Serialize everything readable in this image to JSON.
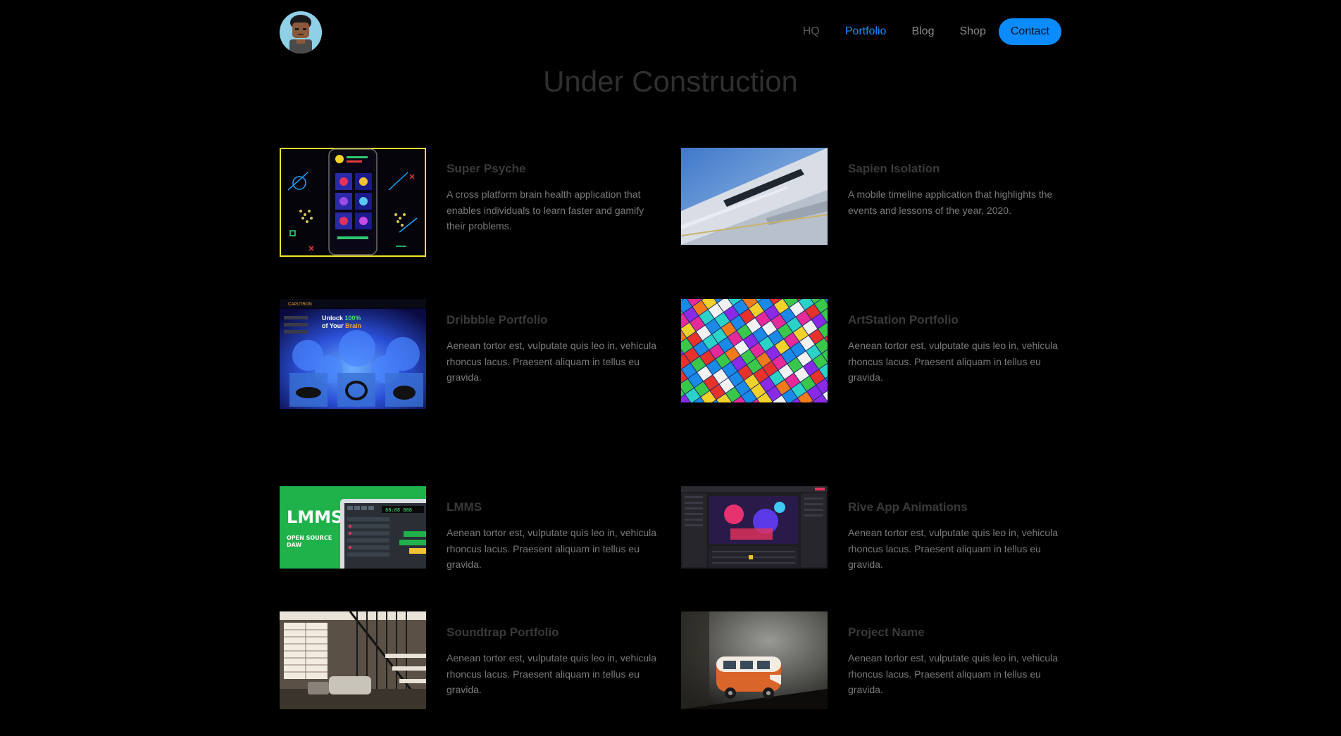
{
  "nav": {
    "items": [
      {
        "label": "HQ"
      },
      {
        "label": "Portfolio"
      },
      {
        "label": "Blog"
      },
      {
        "label": "Shop"
      },
      {
        "label": "Contact"
      }
    ],
    "active_color": "#1a8cff",
    "contact_bg": "#0a8bff"
  },
  "page": {
    "title": "Under Construction"
  },
  "projects": [
    {
      "title": "Super Psyche",
      "description": "A cross platform brain health application that enables individuals to learn faster and gamify their problems.",
      "thumb_text": ""
    },
    {
      "title": "Sapien Isolation",
      "description": "A mobile timeline application that highlights the events and lessons of the year, 2020."
    },
    {
      "title": "Dribbble Portfolio",
      "description": "Aenean tortor est, vulputate quis leo in, vehicula rhoncus lacus. Praesent aliquam in tellus eu gravida.",
      "thumb_brand": "CAPUTRON",
      "thumb_headline_1": "Unlock ",
      "thumb_headline_highlight": "100%",
      "thumb_headline_2": "of Your ",
      "thumb_headline_highlight_2": "Brain"
    },
    {
      "title": "ArtStation Portfolio",
      "description": "Aenean tortor est, vulputate quis leo in, vehicula rhoncus lacus. Praesent aliquam in tellus eu gravida."
    },
    {
      "title": "LMMS",
      "description": "Aenean tortor est, vulputate quis leo in, vehicula rhoncus lacus. Praesent aliquam in tellus eu gravida.",
      "thumb_logo": "LMMS",
      "thumb_sub": "OPEN SOURCE",
      "thumb_sub_2": "DAW"
    },
    {
      "title": "Rive App Animations",
      "description": "Aenean tortor est, vulputate quis leo in, vehicula rhoncus lacus. Praesent aliquam in tellus eu gravida."
    },
    {
      "title": "Soundtrap Portfolio",
      "description": "Aenean tortor est, vulputate quis leo in, vehicula rhoncus lacus. Praesent aliquam in tellus eu gravida."
    },
    {
      "title": "Project Name",
      "description": "Aenean tortor est, vulputate quis leo in, vehicula rhoncus lacus. Praesent aliquam in tellus eu gravida."
    }
  ]
}
